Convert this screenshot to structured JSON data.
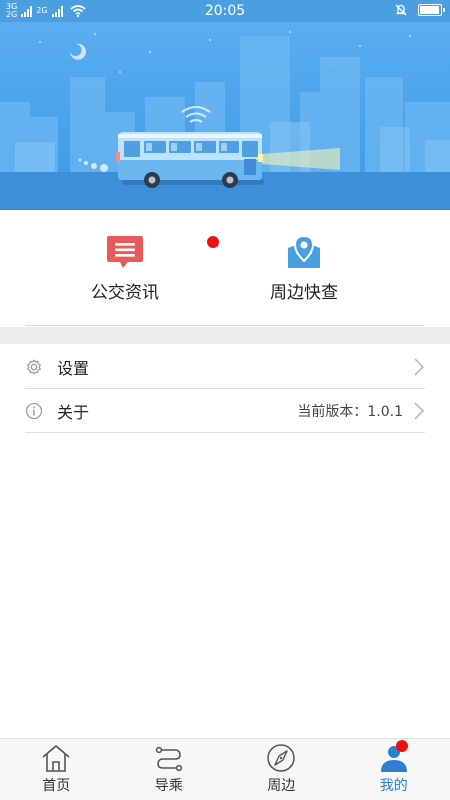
{
  "status_bar": {
    "network_1": "3G",
    "network_2": "2G",
    "network_3": "2G",
    "time": "20:05",
    "battery_level": 0.95
  },
  "quick_actions": [
    {
      "label": "公交资讯",
      "icon": "news-list-icon",
      "has_badge": true
    },
    {
      "label": "周边快查",
      "icon": "map-pin-icon",
      "has_badge": false
    }
  ],
  "menu": {
    "settings": {
      "label": "设置",
      "icon": "gear-icon"
    },
    "about": {
      "label": "关于",
      "icon": "info-icon",
      "value": "当前版本：1.0.1"
    }
  },
  "bottom_nav": [
    {
      "label": "首页",
      "icon": "home-icon",
      "active": false
    },
    {
      "label": "导乘",
      "icon": "route-icon",
      "active": false
    },
    {
      "label": "周边",
      "icon": "compass-icon",
      "active": false
    },
    {
      "label": "我的",
      "icon": "user-icon",
      "active": true,
      "has_badge": true
    }
  ],
  "colors": {
    "primary": "#2e7fd0",
    "banner": "#4aa2ea",
    "news_icon": "#e85a5a",
    "map_icon": "#4a9fe0",
    "badge": "#ee1111"
  }
}
